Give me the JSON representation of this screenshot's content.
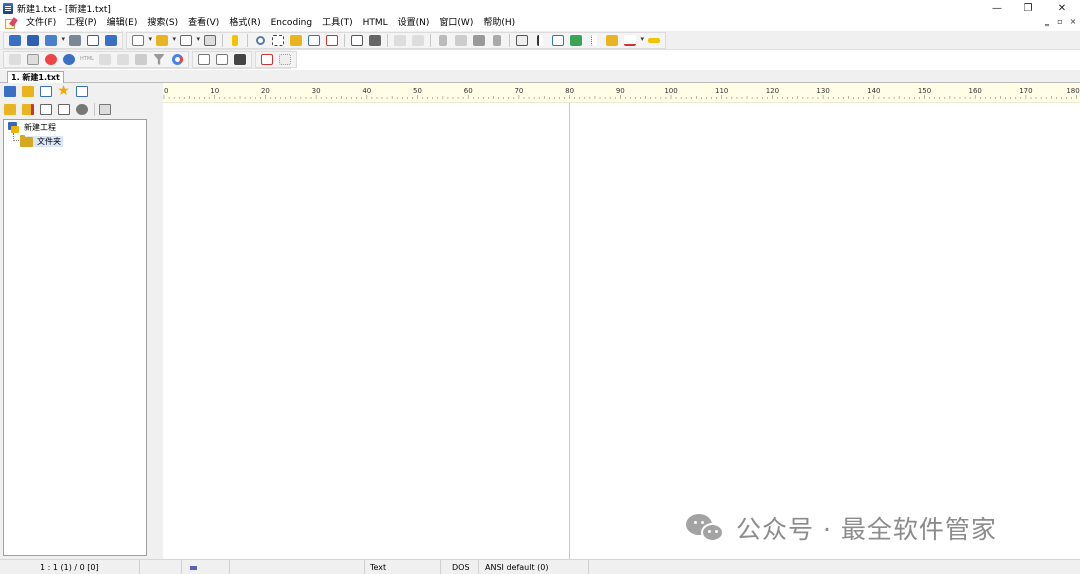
{
  "window": {
    "title": "新建1.txt - [新建1.txt]",
    "controls": {
      "minimize": "—",
      "restore": "❐",
      "close": "✕"
    }
  },
  "menu": {
    "items": [
      "文件(F)",
      "工程(P)",
      "编辑(E)",
      "搜索(S)",
      "查看(V)",
      "格式(R)",
      "Encoding",
      "工具(T)",
      "HTML",
      "设置(N)",
      "窗口(W)",
      "帮助(H)"
    ],
    "doc_controls": {
      "minimize": "‗",
      "restore": "▫",
      "close": "×"
    }
  },
  "toolbar_html_label": "HTML",
  "tab": {
    "label": "1. 新建1.txt"
  },
  "project": {
    "root": "新建工程",
    "child": "文件夹"
  },
  "ruler": {
    "labels": [
      "0",
      "10",
      "20",
      "30",
      "40",
      "50",
      "60",
      "70",
      "80",
      "90",
      "100",
      "110",
      "120",
      "130",
      "140",
      "150",
      "160",
      "170",
      "180"
    ]
  },
  "watermark": "公众号 · 最全软件管家",
  "status": {
    "position": "1 : 1 (1) / 0  [0]",
    "mode": "Text",
    "line_ending": "DOS",
    "encoding": "ANSI default (0)"
  },
  "colors": {
    "ruler_bg": "#fffde6",
    "chrome_bg": "#f0f0f0",
    "selection": "#dbe7f6",
    "accent_blue": "#3867b8",
    "folder": "#d6a820"
  }
}
